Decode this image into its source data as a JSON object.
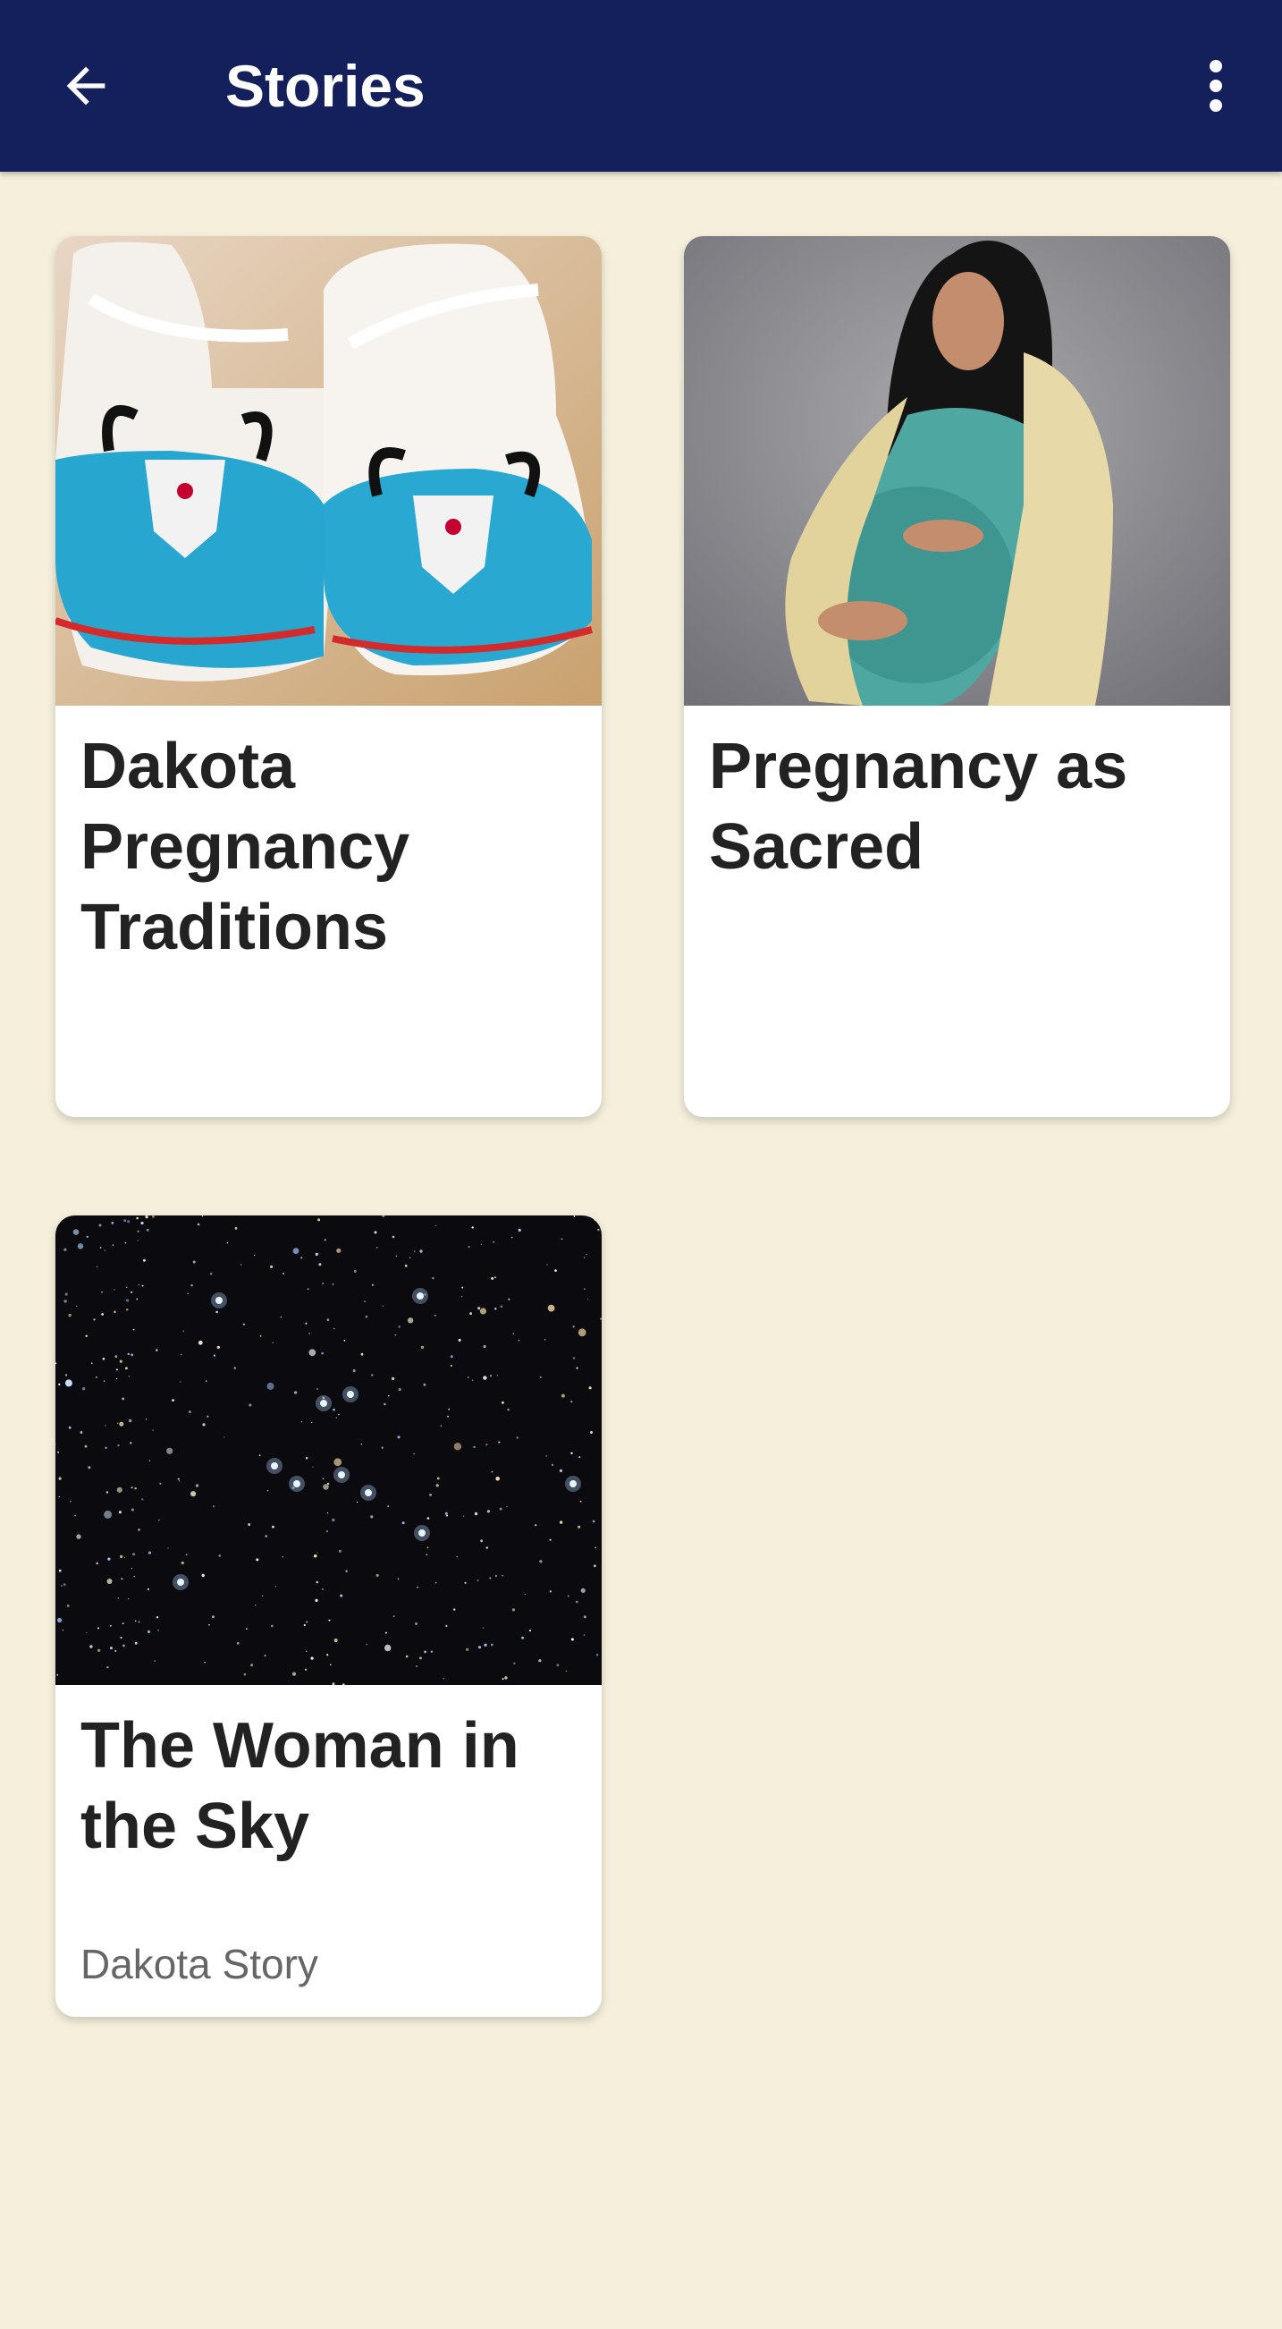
{
  "appbar": {
    "title": "Stories",
    "back_icon": "arrow-back-icon",
    "menu_icon": "more-vert-icon",
    "color": "#13205c"
  },
  "background_color": "#f5efdc",
  "cards": [
    {
      "title": "Dakota Pregnancy Traditions",
      "subtitle": "",
      "image": "beaded moccasins photo"
    },
    {
      "title": "Pregnancy as Sacred",
      "subtitle": "",
      "image": "pregnant woman with shawl photo"
    },
    {
      "title": "The Woman in the Sky",
      "subtitle": "Dakota Story",
      "image": "star cluster photo"
    }
  ]
}
